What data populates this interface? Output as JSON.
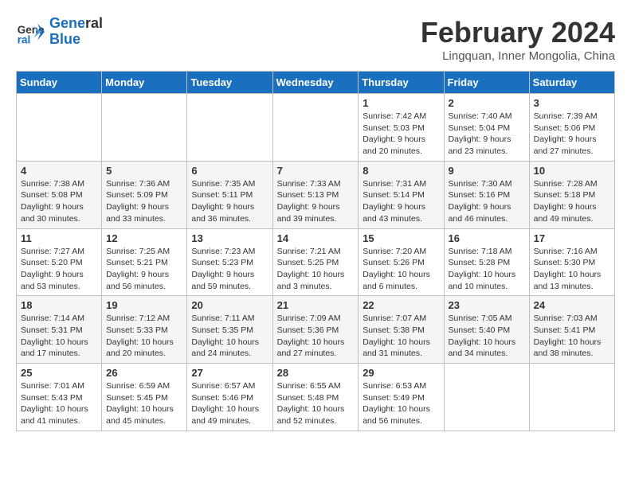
{
  "logo": {
    "line1": "General",
    "line2": "Blue"
  },
  "title": "February 2024",
  "location": "Lingquan, Inner Mongolia, China",
  "days_of_week": [
    "Sunday",
    "Monday",
    "Tuesday",
    "Wednesday",
    "Thursday",
    "Friday",
    "Saturday"
  ],
  "weeks": [
    [
      {
        "day": "",
        "info": ""
      },
      {
        "day": "",
        "info": ""
      },
      {
        "day": "",
        "info": ""
      },
      {
        "day": "",
        "info": ""
      },
      {
        "day": "1",
        "info": "Sunrise: 7:42 AM\nSunset: 5:03 PM\nDaylight: 9 hours\nand 20 minutes."
      },
      {
        "day": "2",
        "info": "Sunrise: 7:40 AM\nSunset: 5:04 PM\nDaylight: 9 hours\nand 23 minutes."
      },
      {
        "day": "3",
        "info": "Sunrise: 7:39 AM\nSunset: 5:06 PM\nDaylight: 9 hours\nand 27 minutes."
      }
    ],
    [
      {
        "day": "4",
        "info": "Sunrise: 7:38 AM\nSunset: 5:08 PM\nDaylight: 9 hours\nand 30 minutes."
      },
      {
        "day": "5",
        "info": "Sunrise: 7:36 AM\nSunset: 5:09 PM\nDaylight: 9 hours\nand 33 minutes."
      },
      {
        "day": "6",
        "info": "Sunrise: 7:35 AM\nSunset: 5:11 PM\nDaylight: 9 hours\nand 36 minutes."
      },
      {
        "day": "7",
        "info": "Sunrise: 7:33 AM\nSunset: 5:13 PM\nDaylight: 9 hours\nand 39 minutes."
      },
      {
        "day": "8",
        "info": "Sunrise: 7:31 AM\nSunset: 5:14 PM\nDaylight: 9 hours\nand 43 minutes."
      },
      {
        "day": "9",
        "info": "Sunrise: 7:30 AM\nSunset: 5:16 PM\nDaylight: 9 hours\nand 46 minutes."
      },
      {
        "day": "10",
        "info": "Sunrise: 7:28 AM\nSunset: 5:18 PM\nDaylight: 9 hours\nand 49 minutes."
      }
    ],
    [
      {
        "day": "11",
        "info": "Sunrise: 7:27 AM\nSunset: 5:20 PM\nDaylight: 9 hours\nand 53 minutes."
      },
      {
        "day": "12",
        "info": "Sunrise: 7:25 AM\nSunset: 5:21 PM\nDaylight: 9 hours\nand 56 minutes."
      },
      {
        "day": "13",
        "info": "Sunrise: 7:23 AM\nSunset: 5:23 PM\nDaylight: 9 hours\nand 59 minutes."
      },
      {
        "day": "14",
        "info": "Sunrise: 7:21 AM\nSunset: 5:25 PM\nDaylight: 10 hours\nand 3 minutes."
      },
      {
        "day": "15",
        "info": "Sunrise: 7:20 AM\nSunset: 5:26 PM\nDaylight: 10 hours\nand 6 minutes."
      },
      {
        "day": "16",
        "info": "Sunrise: 7:18 AM\nSunset: 5:28 PM\nDaylight: 10 hours\nand 10 minutes."
      },
      {
        "day": "17",
        "info": "Sunrise: 7:16 AM\nSunset: 5:30 PM\nDaylight: 10 hours\nand 13 minutes."
      }
    ],
    [
      {
        "day": "18",
        "info": "Sunrise: 7:14 AM\nSunset: 5:31 PM\nDaylight: 10 hours\nand 17 minutes."
      },
      {
        "day": "19",
        "info": "Sunrise: 7:12 AM\nSunset: 5:33 PM\nDaylight: 10 hours\nand 20 minutes."
      },
      {
        "day": "20",
        "info": "Sunrise: 7:11 AM\nSunset: 5:35 PM\nDaylight: 10 hours\nand 24 minutes."
      },
      {
        "day": "21",
        "info": "Sunrise: 7:09 AM\nSunset: 5:36 PM\nDaylight: 10 hours\nand 27 minutes."
      },
      {
        "day": "22",
        "info": "Sunrise: 7:07 AM\nSunset: 5:38 PM\nDaylight: 10 hours\nand 31 minutes."
      },
      {
        "day": "23",
        "info": "Sunrise: 7:05 AM\nSunset: 5:40 PM\nDaylight: 10 hours\nand 34 minutes."
      },
      {
        "day": "24",
        "info": "Sunrise: 7:03 AM\nSunset: 5:41 PM\nDaylight: 10 hours\nand 38 minutes."
      }
    ],
    [
      {
        "day": "25",
        "info": "Sunrise: 7:01 AM\nSunset: 5:43 PM\nDaylight: 10 hours\nand 41 minutes."
      },
      {
        "day": "26",
        "info": "Sunrise: 6:59 AM\nSunset: 5:45 PM\nDaylight: 10 hours\nand 45 minutes."
      },
      {
        "day": "27",
        "info": "Sunrise: 6:57 AM\nSunset: 5:46 PM\nDaylight: 10 hours\nand 49 minutes."
      },
      {
        "day": "28",
        "info": "Sunrise: 6:55 AM\nSunset: 5:48 PM\nDaylight: 10 hours\nand 52 minutes."
      },
      {
        "day": "29",
        "info": "Sunrise: 6:53 AM\nSunset: 5:49 PM\nDaylight: 10 hours\nand 56 minutes."
      },
      {
        "day": "",
        "info": ""
      },
      {
        "day": "",
        "info": ""
      }
    ]
  ]
}
